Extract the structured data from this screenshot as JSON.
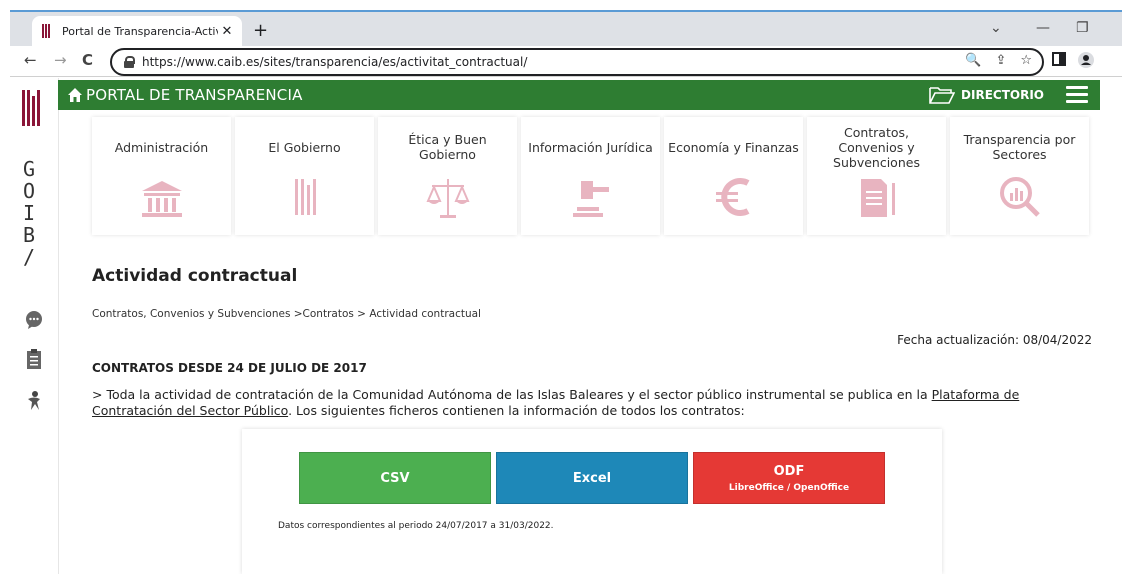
{
  "browser": {
    "tab_title": "Portal de Transparencia-Activida…",
    "tab_close": "✕",
    "new_tab": "+",
    "url": "https://www.caib.es/sites/transparencia/es/activitat_contractual/",
    "nav_back": "←",
    "nav_forward": "→",
    "nav_reload": "C",
    "window_min": "—",
    "window_restore": "❐",
    "window_chevron": "⌄",
    "omni_icons": [
      "zoom-icon",
      "share-icon",
      "star-icon"
    ],
    "omni_zoom": "🔍",
    "omni_share": "⇪",
    "omni_star": "☆"
  },
  "sidebar": {
    "letters": [
      "G",
      "O",
      "I",
      "B",
      "/"
    ],
    "icons": [
      "chat-icon",
      "clipboard-icon",
      "accessibility-icon"
    ]
  },
  "portal": {
    "title": "PORTAL DE TRANSPARENCIA",
    "directory": "DIRECTORIO",
    "color": "#2e7d32"
  },
  "categories": [
    {
      "label": "Administración",
      "icon": "building-icon"
    },
    {
      "label": "El Gobierno",
      "icon": "government-logo-icon"
    },
    {
      "label": "Ética y Buen Gobierno",
      "icon": "scales-icon"
    },
    {
      "label": "Información Jurídica",
      "icon": "gavel-icon"
    },
    {
      "label": "Economía y Finanzas",
      "icon": "euro-icon"
    },
    {
      "label": "Contratos, Convenios y Subvenciones",
      "icon": "document-icon"
    },
    {
      "label": "Transparencia por Sectores",
      "icon": "chart-search-icon"
    }
  ],
  "content": {
    "heading": "Actividad contractual",
    "breadcrumb": "Contratos, Convenios y Subvenciones >Contratos > Actividad contractual",
    "updated": "Fecha actualización: 08/04/2022",
    "subheading": "CONTRATOS DESDE 24 DE JULIO DE 2017",
    "para_before": "> Toda la actividad de contratación de la Comunidad Autónoma de las Islas Baleares y el sector público instrumental se publica en la ",
    "para_link": "Plataforma de Contratación del Sector Público",
    "para_after": ". Los siguientes ficheros contienen la información de todos los contratos:"
  },
  "downloads": {
    "csv": {
      "label": "CSV",
      "color": "#4caf50"
    },
    "excel": {
      "label": "Excel",
      "color": "#1e88b8"
    },
    "odf": {
      "label": "ODF",
      "sublabel": "LibreOffice / OpenOffice",
      "color": "#e53935"
    },
    "note": "Datos correspondientes al periodo 24/07/2017 a 31/03/2022."
  }
}
